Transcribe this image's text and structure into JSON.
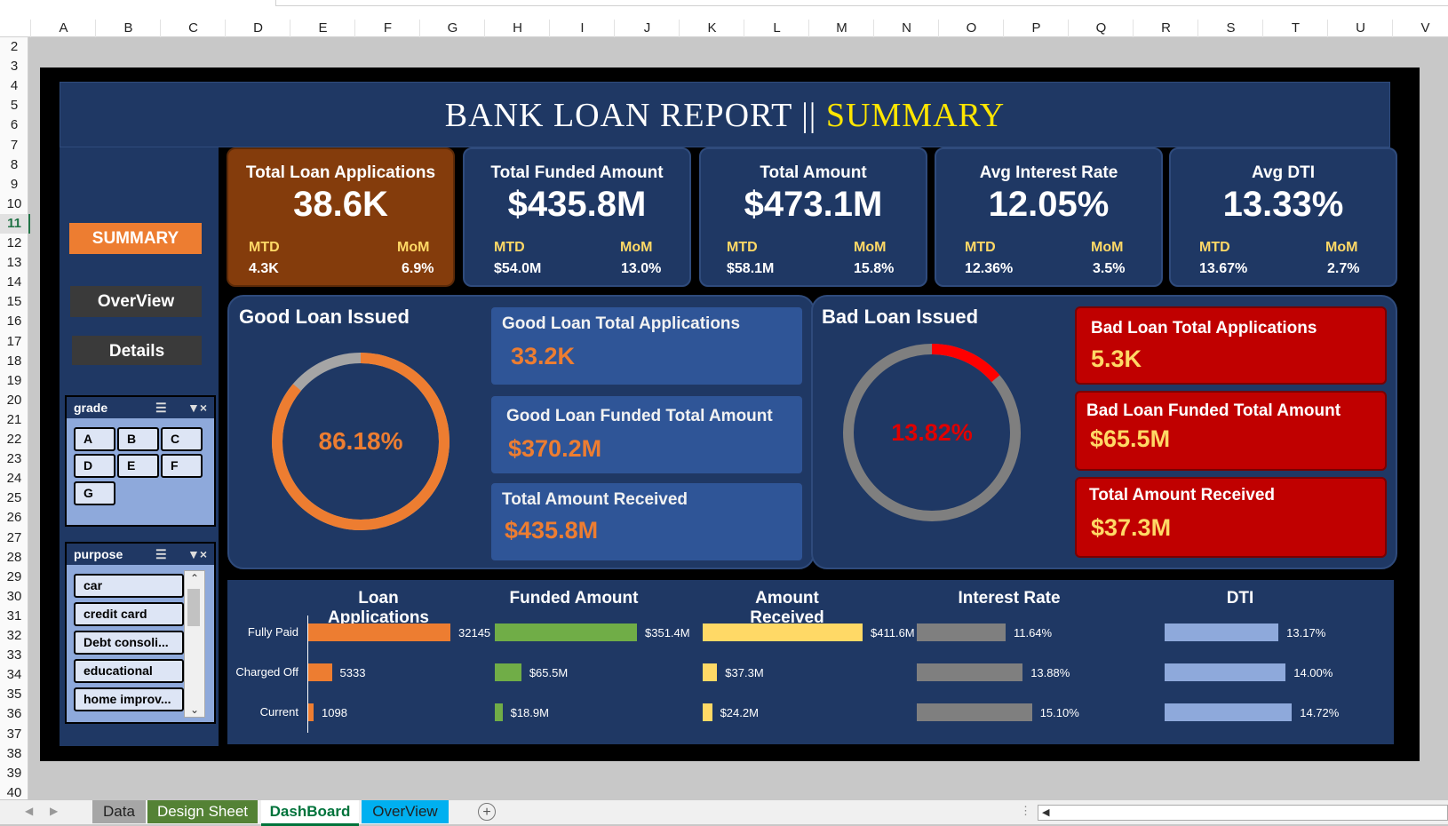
{
  "columns": [
    "A",
    "B",
    "C",
    "D",
    "E",
    "F",
    "G",
    "H",
    "I",
    "J",
    "K",
    "L",
    "M",
    "N",
    "O",
    "P",
    "Q",
    "R",
    "S",
    "T",
    "U",
    "V"
  ],
  "rows": [
    "2",
    "3",
    "4",
    "5",
    "6",
    "7",
    "8",
    "9",
    "10",
    "11",
    "12",
    "13",
    "14",
    "15",
    "16",
    "17",
    "18",
    "19",
    "20",
    "21",
    "22",
    "23",
    "24",
    "25",
    "26",
    "27",
    "28",
    "29",
    "30",
    "31",
    "32",
    "33",
    "34",
    "35",
    "36",
    "37",
    "38",
    "39",
    "40"
  ],
  "selected_row": "11",
  "title": {
    "main": "BANK LOAN REPORT || ",
    "highlight": "SUMMARY"
  },
  "nav": {
    "summary": "SUMMARY",
    "overview": "OverView",
    "details": "Details"
  },
  "slicers": {
    "grade": {
      "title": "grade",
      "items": [
        "A",
        "B",
        "C",
        "D",
        "E",
        "F",
        "G"
      ]
    },
    "purpose": {
      "title": "purpose",
      "items": [
        "car",
        "credit card",
        "Debt consoli...",
        "educational",
        "home improv..."
      ]
    }
  },
  "kpis": [
    {
      "label": "Total Loan Applications",
      "value": "38.6K",
      "mtd_label": "MTD",
      "mtd": "4.3K",
      "mom_label": "MoM",
      "mom": "6.9%"
    },
    {
      "label": "Total Funded  Amount",
      "value": "$435.8M",
      "mtd_label": "MTD",
      "mtd": "$54.0M",
      "mom_label": "MoM",
      "mom": "13.0%"
    },
    {
      "label": "Total Amount",
      "value": "$473.1M",
      "mtd_label": "MTD",
      "mtd": "$58.1M",
      "mom_label": "MoM",
      "mom": "15.8%"
    },
    {
      "label": "Avg Interest Rate",
      "value": "12.05%",
      "mtd_label": "MTD",
      "mtd": "12.36%",
      "mom_label": "MoM",
      "mom": "3.5%"
    },
    {
      "label": "Avg DTI",
      "value": "13.33%",
      "mtd_label": "MTD",
      "mtd": "13.67%",
      "mom_label": "MoM",
      "mom": "2.7%"
    }
  ],
  "good_loan": {
    "title": "Good Loan Issued",
    "percent_label": "86.18%",
    "percent": 0.8618,
    "boxes": [
      {
        "label": "Good Loan Total Applications",
        "value": "33.2K"
      },
      {
        "label": "Good Loan Funded Total Amount",
        "value": "$370.2M"
      },
      {
        "label": "Total Amount Received",
        "value": "$435.8M"
      }
    ]
  },
  "bad_loan": {
    "title": "Bad Loan Issued",
    "percent_label": "13.82%",
    "percent": 0.1382,
    "boxes": [
      {
        "label": "Bad Loan Total Applications",
        "value": "5.3K"
      },
      {
        "label": "Bad Loan Funded Total Amount",
        "value": "$65.5M"
      },
      {
        "label": "Total Amount Received",
        "value": "$37.3M"
      }
    ]
  },
  "colors": {
    "orange": "#ed7d31",
    "green": "#70ad47",
    "yellow": "#ffd966",
    "gray": "#7f7f7f",
    "blue": "#8ea9db",
    "red": "#ff0000",
    "navy": "#1f3864"
  },
  "chart_data": {
    "type": "bar",
    "categories": [
      "Fully Paid",
      "Charged Off",
      "Current"
    ],
    "charts": [
      {
        "title": "Loan Applications",
        "values": [
          32145,
          5333,
          1098
        ],
        "labels": [
          "32145",
          "5333",
          "1098"
        ]
      },
      {
        "title": "Funded Amount",
        "values": [
          351.4,
          65.5,
          18.9
        ],
        "labels": [
          "$351.4M",
          "$65.5M",
          "$18.9M"
        ]
      },
      {
        "title": "Amount Received",
        "values": [
          411.6,
          37.3,
          24.2
        ],
        "labels": [
          "$411.6M",
          "$37.3M",
          "$24.2M"
        ]
      },
      {
        "title": "Interest Rate",
        "values": [
          11.64,
          13.88,
          15.1
        ],
        "labels": [
          "11.64%",
          "13.88%",
          "15.10%"
        ]
      },
      {
        "title": "DTI",
        "values": [
          13.17,
          14.0,
          14.72
        ],
        "labels": [
          "13.17%",
          "14.00%",
          "14.72%"
        ]
      }
    ]
  },
  "sheet_tabs": [
    "Data",
    "Design Sheet",
    "DashBoard",
    "OverView"
  ],
  "add_sheet": "+"
}
